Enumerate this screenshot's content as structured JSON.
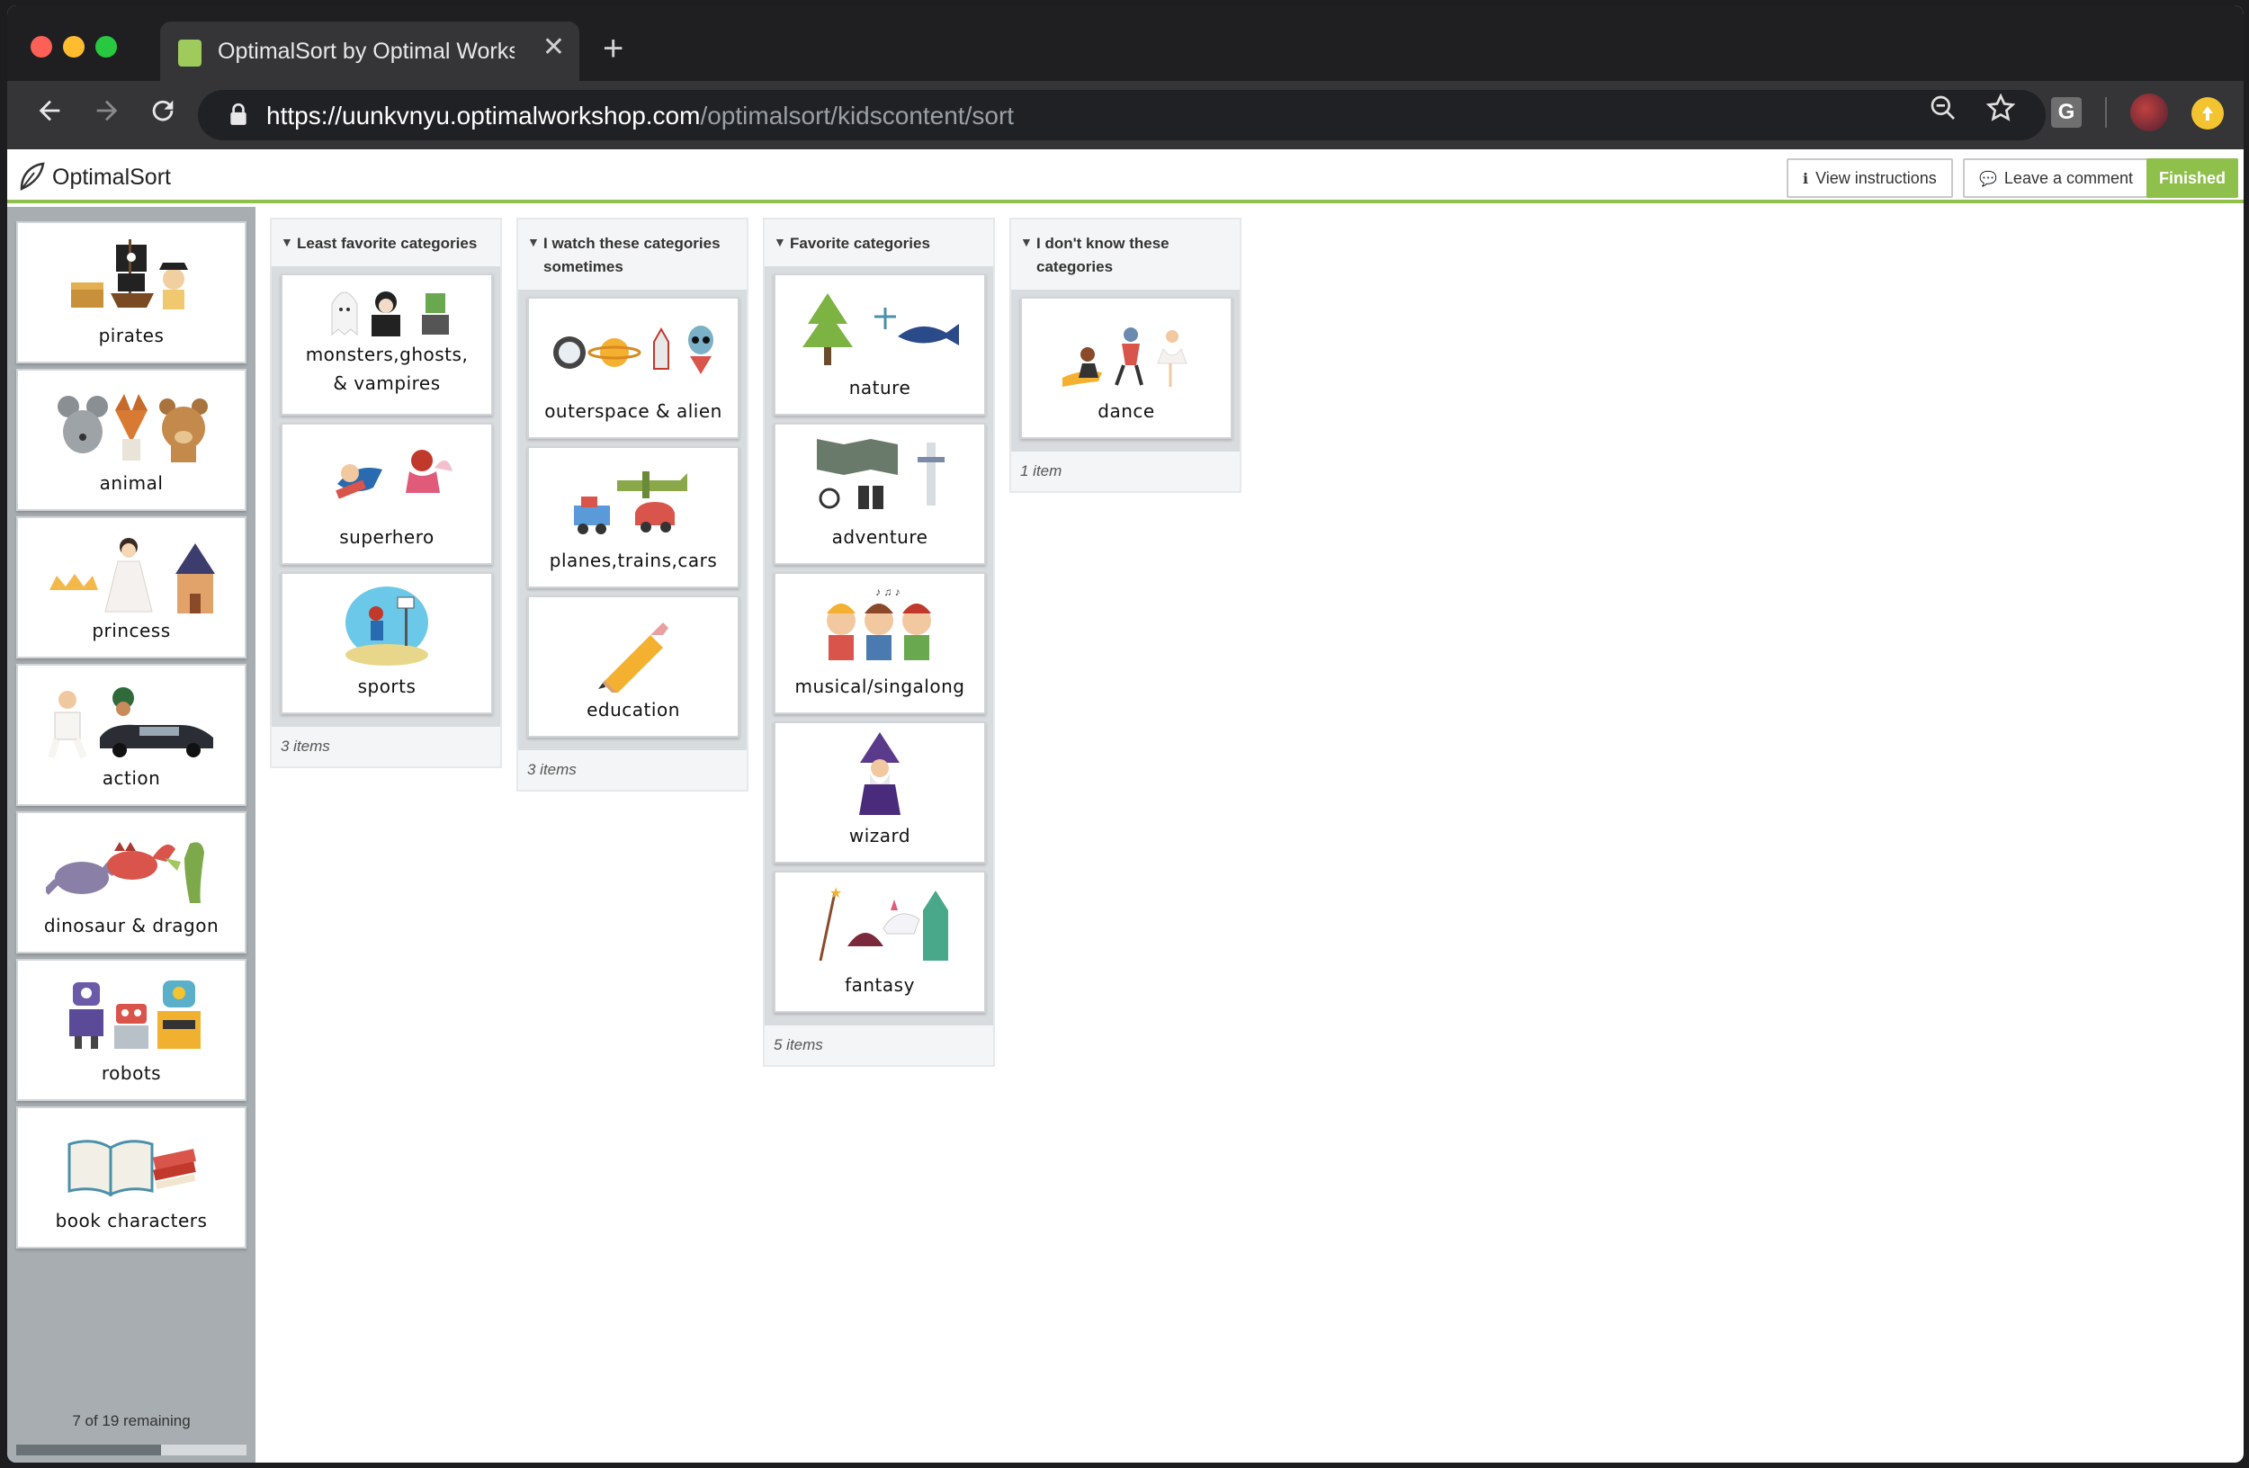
{
  "browser": {
    "tab_title": "OptimalSort by Optimal Worksh",
    "tab_close": "✕",
    "new_tab": "+",
    "url_host": "https://uunkvnyu.optimalworkshop.com",
    "url_path": "/optimalsort/kidscontent/sort",
    "extension_label": "G"
  },
  "header": {
    "logo_text": "OptimalSort",
    "view_instructions": "View instructions",
    "leave_comment": "Leave a comment",
    "finished": "Finished"
  },
  "sidebar": {
    "cards": [
      {
        "label": "pirates"
      },
      {
        "label": "animal"
      },
      {
        "label": "princess"
      },
      {
        "label": "action"
      },
      {
        "label": "dinosaur & dragon"
      },
      {
        "label": "robots"
      },
      {
        "label": "book characters"
      }
    ],
    "remaining_text": "7 of 19 remaining",
    "progress_fraction": 0.63
  },
  "categories": [
    {
      "title": "Least favorite categories",
      "cards": [
        {
          "label": "monsters,ghosts,",
          "label2": "& vampires"
        },
        {
          "label": "superhero"
        },
        {
          "label": "sports"
        }
      ],
      "count": "3 items"
    },
    {
      "title": "I watch these categories sometimes",
      "cards": [
        {
          "label": "outerspace & alien"
        },
        {
          "label": "planes,trains,cars"
        },
        {
          "label": "education"
        }
      ],
      "count": "3 items"
    },
    {
      "title": "Favorite categories",
      "cards": [
        {
          "label": "nature"
        },
        {
          "label": "adventure"
        },
        {
          "label": "musical/singalong"
        },
        {
          "label": "wizard"
        },
        {
          "label": "fantasy"
        }
      ],
      "count": "5 items"
    },
    {
      "title": "I don't know these categories",
      "cards": [
        {
          "label": "dance"
        }
      ],
      "count": "1 item"
    }
  ]
}
